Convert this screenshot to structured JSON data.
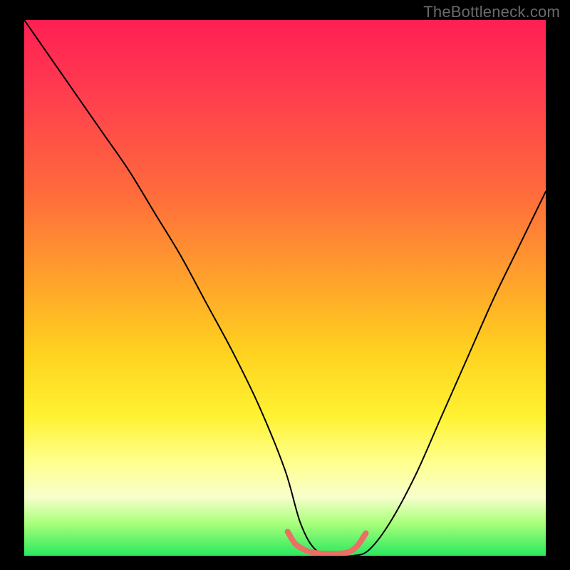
{
  "watermark": "TheBottleneck.com",
  "chart_data": {
    "type": "line",
    "title": "",
    "xlabel": "",
    "ylabel": "",
    "xlim": [
      0,
      100
    ],
    "ylim": [
      0,
      100
    ],
    "series": [
      {
        "name": "curve-black",
        "color": "#000000",
        "x": [
          0,
          5,
          10,
          15,
          20,
          25,
          30,
          35,
          40,
          45,
          50,
          53,
          56,
          60,
          63,
          66,
          70,
          75,
          80,
          85,
          90,
          95,
          100
        ],
        "y": [
          100,
          93,
          86,
          79,
          72,
          64,
          56,
          47,
          38,
          28,
          16,
          6,
          1,
          0,
          0,
          1,
          6,
          15,
          26,
          37,
          48,
          58,
          68
        ]
      }
    ],
    "highlight": {
      "name": "bottom-band-red",
      "color": "#ea6f64",
      "thickness": 8,
      "x": [
        50.5,
        52,
        54,
        56,
        58,
        60,
        62,
        63,
        64,
        65.5
      ],
      "y": [
        4.5,
        2.2,
        1.0,
        0.5,
        0.4,
        0.4,
        0.6,
        1.1,
        2.0,
        4.2
      ]
    },
    "gradient_stops": [
      {
        "pos": 0,
        "color": "#ff1f53"
      },
      {
        "pos": 12,
        "color": "#ff3950"
      },
      {
        "pos": 32,
        "color": "#ff6a3c"
      },
      {
        "pos": 48,
        "color": "#ffa02c"
      },
      {
        "pos": 62,
        "color": "#ffd21f"
      },
      {
        "pos": 74,
        "color": "#fff232"
      },
      {
        "pos": 82,
        "color": "#ffff88"
      },
      {
        "pos": 89,
        "color": "#f8ffcb"
      },
      {
        "pos": 94,
        "color": "#a8ff7a"
      },
      {
        "pos": 100,
        "color": "#29e85f"
      }
    ]
  }
}
